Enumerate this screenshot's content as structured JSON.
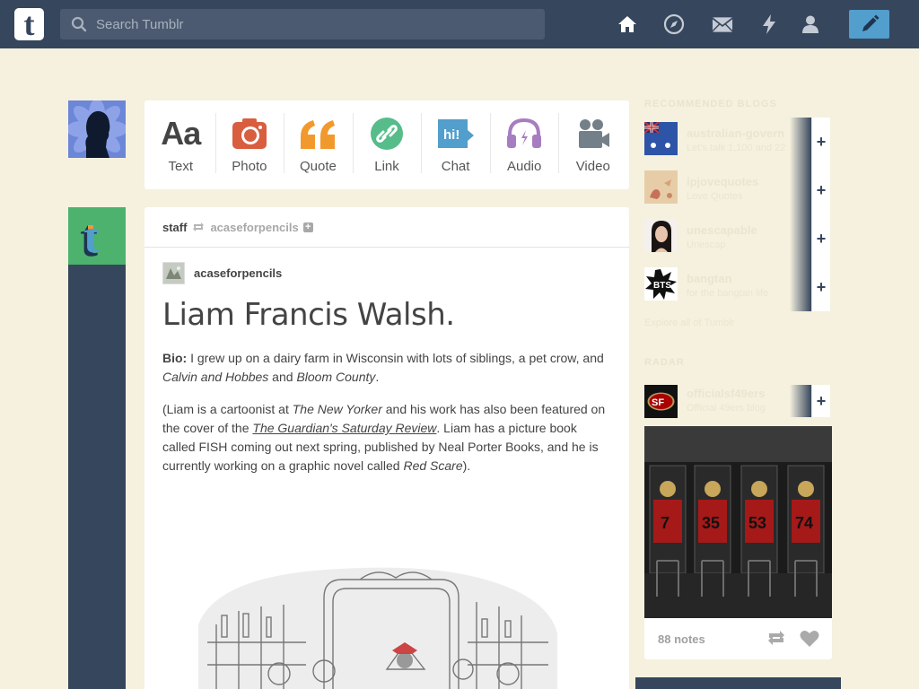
{
  "header": {
    "search_placeholder": "Search Tumblr",
    "nav": [
      "home-icon",
      "explore-icon",
      "inbox-icon",
      "activity-icon",
      "account-icon"
    ],
    "compose": "pencil-icon"
  },
  "post_types": [
    {
      "label": "Text",
      "icon": "text-icon",
      "color": "#444444"
    },
    {
      "label": "Photo",
      "icon": "camera-icon",
      "color": "#d95e40"
    },
    {
      "label": "Quote",
      "icon": "quote-icon",
      "color": "#f2992e"
    },
    {
      "label": "Link",
      "icon": "link-icon",
      "color": "#56bc8a"
    },
    {
      "label": "Chat",
      "icon": "chat-icon",
      "color": "#529ecc"
    },
    {
      "label": "Audio",
      "icon": "audio-icon",
      "color": "#a77dc2"
    },
    {
      "label": "Video",
      "icon": "video-icon",
      "color": "#748089"
    }
  ],
  "post": {
    "reblogger": "staff",
    "origin": "acaseforpencils",
    "source_name": "acaseforpencils",
    "title": "Liam Francis Walsh.",
    "p1_label": "Bio:",
    "p1_a": " I grew up on a dairy farm in Wisconsin with lots of siblings, a pet crow, and ",
    "p1_b": "Calvin and Hobbes",
    "p1_c": " and ",
    "p1_d": "Bloom County",
    "p1_e": ".",
    "p2_a": "(Liam is a cartoonist at ",
    "p2_b": "The New Yorker",
    "p2_c": " and his work has also been featured on the cover of the ",
    "p2_d": "The Guardian's Saturday Review",
    "p2_e": ". Liam has a picture book called FISH coming out next spring, published by Neal Porter Books, and he is currently working on a graphic novel called ",
    "p2_f": "Red Scare",
    "p2_g": ")."
  },
  "sidebar": {
    "recommended_heading": "RECOMMENDED BLOGS",
    "recommended": [
      {
        "name": "australian-govern",
        "sub": "Let's talk 1,100 and 22"
      },
      {
        "name": "ipjovequotes",
        "sub": "Love Quotes"
      },
      {
        "name": "unescapable",
        "sub": "Unescap"
      },
      {
        "name": "bangtan",
        "sub": "for the bangtan life"
      }
    ],
    "explore_link": "Explore all of Tumblr",
    "radar_heading": "RADAR",
    "radar_blog": "officialsf49ers",
    "radar_sub": "Official 49ers blog",
    "jerseys": [
      "7",
      "35",
      "53",
      "74"
    ],
    "notes": "88 notes"
  }
}
